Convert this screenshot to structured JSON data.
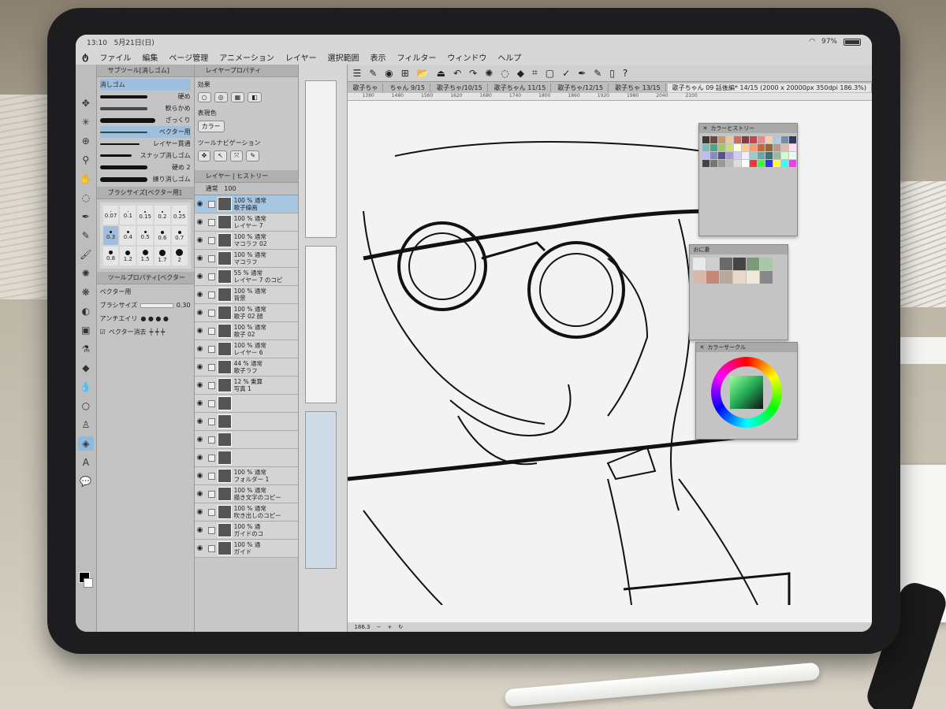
{
  "status": {
    "time": "13:10",
    "date": "5月21日(日)",
    "battery": "97%"
  },
  "menu": [
    "ファイル",
    "編集",
    "ページ管理",
    "アニメーション",
    "レイヤー",
    "選択範囲",
    "表示",
    "フィルター",
    "ウィンドウ",
    "ヘルプ"
  ],
  "subtool": {
    "title": "サブツール[消しゴム]",
    "group": "消しゴム",
    "items": [
      "硬め",
      "軟らかめ",
      "ざっくり",
      "ベクター用",
      "レイヤー貫通",
      "スナップ消しゴム",
      "硬め 2",
      "練り消しゴム"
    ],
    "selected": "ベクター用"
  },
  "brushsize": {
    "title": "ブラシサイズ[ベクター用]",
    "values": [
      "0.07",
      "0.1",
      "0.15",
      "0.2",
      "0.25",
      "0.3",
      "0.4",
      "0.5",
      "0.6",
      "0.7",
      "0.8",
      "1.2",
      "1.5",
      "1.7",
      "2"
    ],
    "selected": "0.3"
  },
  "toolprop": {
    "title": "ツールプロパティ[ベクター",
    "subtitle": "ベクター用",
    "size_label": "ブラシサイズ",
    "size_value": "0.30",
    "aa_label": "アンチエイリ",
    "vector_erase": "ベクター消去"
  },
  "layerprop": {
    "title": "レイヤープロパティ",
    "effect": "効果",
    "expression": "表現色",
    "color": "カラー",
    "nav": "ツールナビゲーション"
  },
  "layers": {
    "tab1": "レイヤー",
    "tab2": "ヒストリー",
    "blend": "通常",
    "opacity": "100",
    "items": [
      {
        "l1": "100 % 通常",
        "l2": "歌子線画",
        "sel": true
      },
      {
        "l1": "100 % 通常",
        "l2": "レイヤー 7"
      },
      {
        "l1": "100 % 通常",
        "l2": "マコラフ 02"
      },
      {
        "l1": "100 % 通常",
        "l2": "マコラフ"
      },
      {
        "l1": "55 % 通常",
        "l2": "レイヤー 7 のコピ"
      },
      {
        "l1": "100 % 通常",
        "l2": "背景"
      },
      {
        "l1": "100 % 通常",
        "l2": "歌子 02 顔"
      },
      {
        "l1": "100 % 通常",
        "l2": "歌子 02"
      },
      {
        "l1": "100 % 通常",
        "l2": "レイヤー 6"
      },
      {
        "l1": "44 % 通常",
        "l2": "歌子ラフ"
      },
      {
        "l1": "12 % 乗算",
        "l2": "写真 1"
      },
      {
        "l1": "",
        "l2": ""
      },
      {
        "l1": "",
        "l2": ""
      },
      {
        "l1": "",
        "l2": ""
      },
      {
        "l1": "",
        "l2": ""
      },
      {
        "l1": "100 % 通常",
        "l2": "フォルダー 1"
      },
      {
        "l1": "100 % 通常",
        "l2": "描き文字のコピー"
      },
      {
        "l1": "100 % 通常",
        "l2": "吹き出しのコピー"
      },
      {
        "l1": "100 % 通",
        "l2": "ガイドのコ"
      },
      {
        "l1": "100 % 通",
        "l2": "ガイド"
      }
    ]
  },
  "tabs": [
    "歌子ちゃ",
    "ちゃん 9/15",
    "歌子ちゃ/10/15",
    "歌子ちゃん 11/15",
    "歌子ちゃ/12/15",
    "歌子ちゃ 13/15",
    "歌子ちゃん 09 話後編* 14/15 (2000 x 20000px 350dpi 186.3%)"
  ],
  "ruler": [
    "1380",
    "1480",
    "1560",
    "1620",
    "1680",
    "1740",
    "1800",
    "1860",
    "1920",
    "1980",
    "2040",
    "2100"
  ],
  "zoom": "186.3",
  "color_history": {
    "title": "カラーヒストリー"
  },
  "color_set": {
    "title": "おに妻"
  },
  "color_circle": {
    "title": "カラーサークル"
  },
  "colors": {
    "accent": "#9fbfdc",
    "history": [
      "#3a3a3a",
      "#6c4b3a",
      "#c89a6a",
      "#e8c9a0",
      "#d36a5a",
      "#8a3a3a",
      "#c44",
      "#e88",
      "#f5d0b0",
      "#aacbe8",
      "#6f8fb0",
      "#336",
      "#7bb",
      "#4a8",
      "#9c6",
      "#cd7",
      "#ffd",
      "#fc8",
      "#f96",
      "#c63",
      "#963",
      "#b98",
      "#dba",
      "#fde",
      "#bbf",
      "#88c",
      "#558",
      "#a9d",
      "#ccf",
      "#eef",
      "#9cc",
      "#6aa",
      "#377",
      "#9b9",
      "#cfc",
      "#efe",
      "#444",
      "#777",
      "#999",
      "#bbb",
      "#ddd",
      "#fff",
      "#f33",
      "#3f3",
      "#33f",
      "#ff3",
      "#3ff",
      "#f3f"
    ],
    "set": [
      "#e9e9e9",
      "#cfcfcf",
      "#6a6a6a",
      "#444",
      "#7a9a7a",
      "#a8c8a8",
      "#d8b8a8",
      "#c88878",
      "#b8a898",
      "#e8d8c8",
      "#f0e8d8",
      "#888"
    ]
  }
}
